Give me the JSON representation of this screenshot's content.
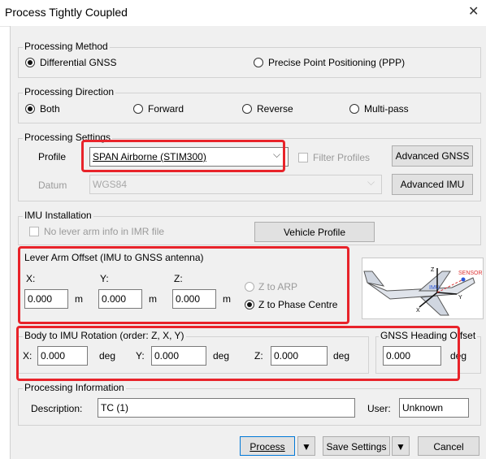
{
  "window": {
    "title": "Process Tightly Coupled",
    "close_glyph": "✕"
  },
  "method": {
    "label": "Processing Method",
    "differential": "Differential GNSS",
    "ppp": "Precise Point Positioning (PPP)"
  },
  "direction": {
    "label": "Processing Direction",
    "both": "Both",
    "forward": "Forward",
    "reverse": "Reverse",
    "multipass": "Multi-pass"
  },
  "settings": {
    "label": "Processing Settings",
    "profile_label": "Profile",
    "profile_value": "SPAN Airborne (STIM300)",
    "filter_profiles": "Filter Profiles",
    "advanced_gnss": "Advanced GNSS",
    "datum_label": "Datum",
    "datum_value": "WGS84",
    "advanced_imu": "Advanced IMU",
    "chevron": "⌵"
  },
  "imu": {
    "label": "IMU Installation",
    "no_lever": "No lever arm info in IMR file",
    "vehicle_profile": "Vehicle Profile"
  },
  "lever": {
    "label": "Lever Arm Offset (IMU to GNSS antenna)",
    "x_label": "X:",
    "x_value": "0.000",
    "y_label": "Y:",
    "y_value": "0.000",
    "z_label": "Z:",
    "z_value": "0.000",
    "unit": "m",
    "z_to_arp": "Z to ARP",
    "z_to_phase": "Z to Phase Centre"
  },
  "diagram": {
    "sensor": "SENSOR",
    "imu": "IMU",
    "z": "Z",
    "x": "X",
    "y": "Y"
  },
  "rotation": {
    "label": "Body to IMU Rotation (order: Z, X, Y)",
    "x_label": "X:",
    "x_value": "0.000",
    "y_label": "Y:",
    "y_value": "0.000",
    "z_label": "Z:",
    "z_value": "0.000",
    "unit": "deg"
  },
  "heading": {
    "label": "GNSS Heading Offset",
    "value": "0.000",
    "unit": "deg"
  },
  "info": {
    "label": "Processing Information",
    "description_label": "Description:",
    "description_value": "TC (1)",
    "user_label": "User:",
    "user_value": "Unknown"
  },
  "buttons": {
    "process": "Process",
    "save": "Save Settings",
    "cancel": "Cancel",
    "dropdown": "▼"
  },
  "colors": {
    "highlight": "#e8232a",
    "dialog_bg": "#f0f0f0",
    "button_bg": "#e1e1e1"
  }
}
